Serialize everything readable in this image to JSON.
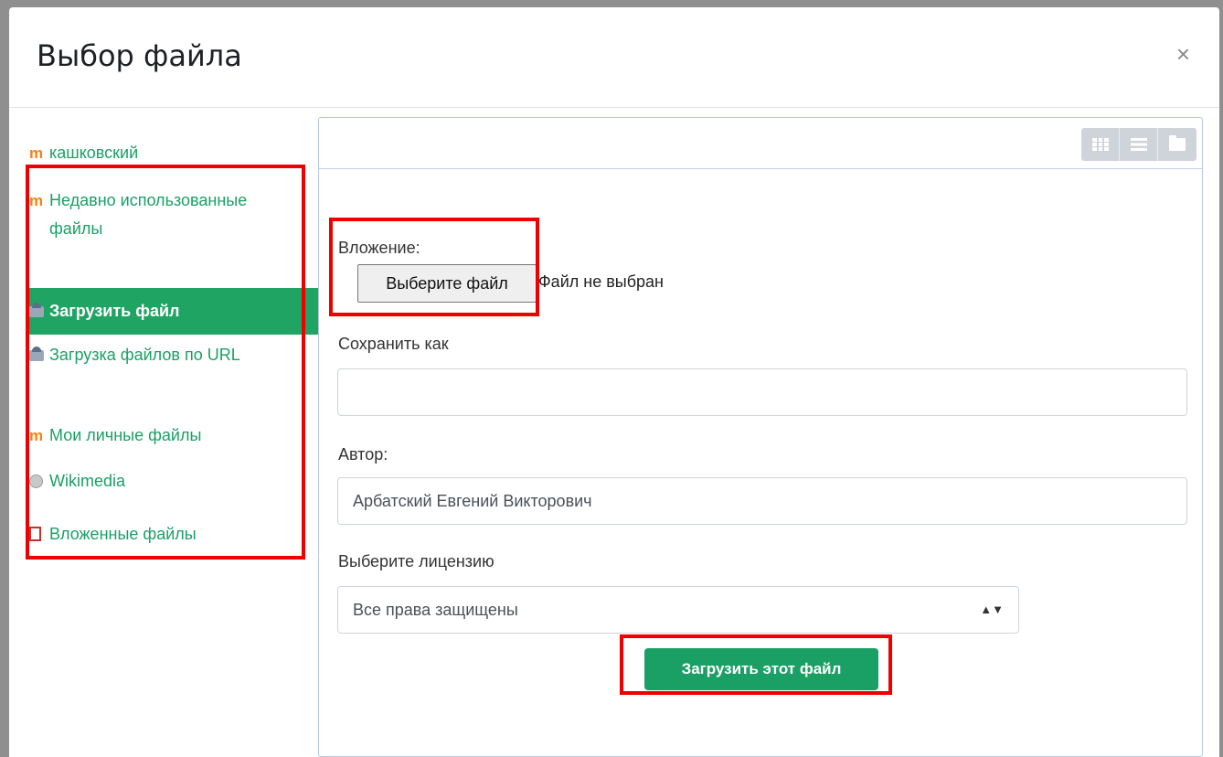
{
  "dialog": {
    "title": "Выбор файла",
    "close_glyph": "×"
  },
  "sidebar": {
    "items": [
      {
        "label": "кашковский",
        "icon": "moodle-icon"
      },
      {
        "label": "Недавно использованные файлы",
        "icon": "moodle-icon"
      },
      {
        "label": "Загрузить файл",
        "icon": "upload-icon",
        "active": true
      },
      {
        "label": "Загрузка файлов по URL",
        "icon": "url-download-icon"
      },
      {
        "label": "Мои личные файлы",
        "icon": "moodle-icon"
      },
      {
        "label": "Wikimedia",
        "icon": "wikimedia-icon"
      },
      {
        "label": "Вложенные файлы",
        "icon": "attachment-icon"
      }
    ]
  },
  "toolbar": {
    "view_buttons": [
      "grid-view-icon",
      "list-view-icon",
      "folder-view-icon"
    ]
  },
  "form": {
    "attachment_label": "Вложение:",
    "choose_file_label": "Выберите файл",
    "no_file_text": "Файл не выбран",
    "save_as_label": "Сохранить как",
    "save_as_value": "",
    "author_label": "Автор:",
    "author_value": "Арбатский Евгений Викторович",
    "license_label": "Выберите лицензию",
    "license_value": "Все права защищены",
    "submit_label": "Загрузить этот файл"
  },
  "colors": {
    "accent": "#1aa064",
    "highlight_box": "#ee0000"
  }
}
